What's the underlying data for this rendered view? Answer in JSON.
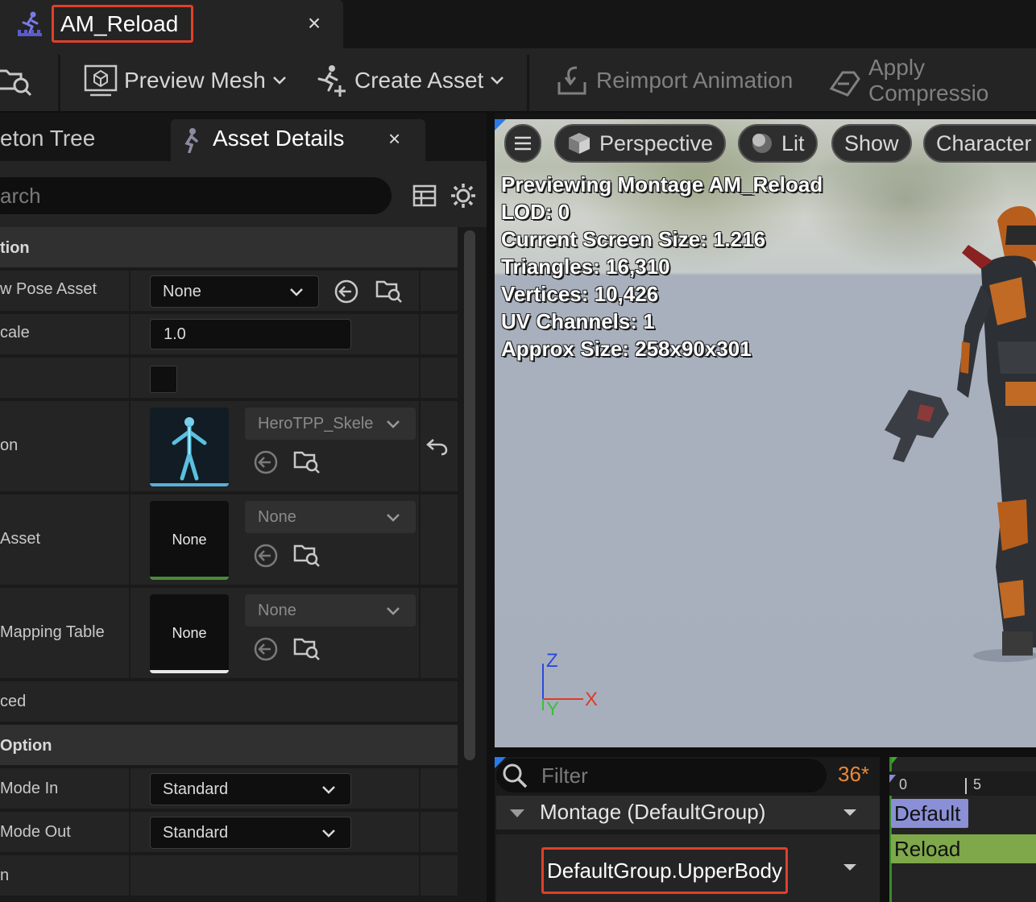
{
  "tab": {
    "title": "AM_Reload",
    "close": "×"
  },
  "toolbar": {
    "preview_mesh": "Preview Mesh",
    "create_asset": "Create Asset",
    "reimport_animation": "Reimport Animation",
    "apply_compression": "Apply Compressio"
  },
  "panel_tabs": {
    "skeleton_tree": "eton Tree",
    "asset_details": "Asset Details",
    "close": "×"
  },
  "search": {
    "placeholder": "arch"
  },
  "sections": {
    "animation": "tion",
    "blend_option": "Option"
  },
  "props": {
    "preview_pose_asset": {
      "label": "w Pose Asset",
      "value": "None"
    },
    "rate_scale": {
      "label": "cale",
      "value": "1.0"
    },
    "skeleton": {
      "label": "on",
      "value": "HeroTPP_Skele"
    },
    "parent_asset": {
      "label": " Asset",
      "thumb": "None",
      "value": "None"
    },
    "mapping_table": {
      "label": "Mapping Table",
      "thumb": "None",
      "value": "None"
    },
    "advanced": {
      "label": "ced"
    },
    "blend_mode_in": {
      "label": "Mode In",
      "value": "Standard"
    },
    "blend_mode_out": {
      "label": "Mode Out",
      "value": "Standard"
    },
    "last_row": {
      "label": "n"
    }
  },
  "viewport": {
    "perspective": "Perspective",
    "lit": "Lit",
    "show": "Show",
    "character": "Character",
    "stats": [
      "Previewing Montage AM_Reload",
      "LOD: 0",
      "Current Screen Size: 1.216",
      "Triangles: 16,310",
      "Vertices: 10,426",
      "UV Channels: 1",
      "Approx Size: 258x90x301"
    ],
    "axes": {
      "z": "Z",
      "x": "X",
      "y": "Y"
    }
  },
  "timeline": {
    "filter_placeholder": "Filter",
    "count": "36*",
    "montage_row": "Montage (DefaultGroup)",
    "group_row": "DefaultGroup.UpperBody",
    "ruler": {
      "t0": "0",
      "t5": "5"
    },
    "section_default": "Default",
    "segment_reload": "Reload"
  },
  "colors": {
    "accent_highlight": "#e0402a",
    "timeline_section": "#8a8fd6",
    "timeline_segment": "#7ea84a",
    "track_count": "#e8893a"
  }
}
